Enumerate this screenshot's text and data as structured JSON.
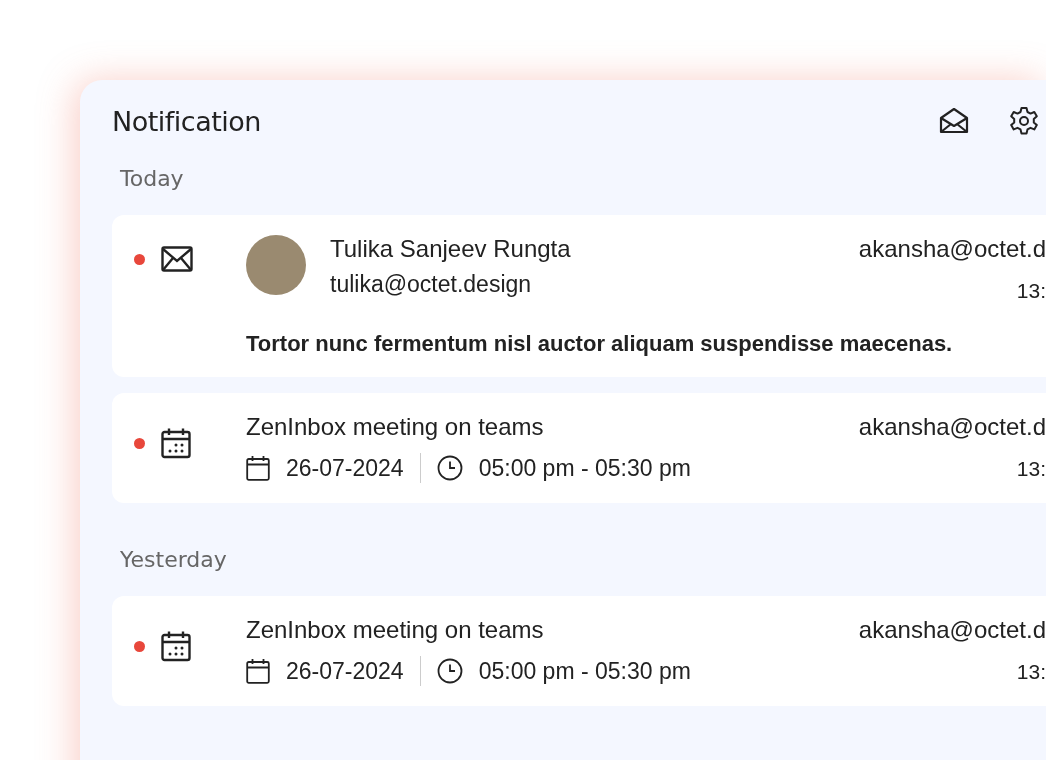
{
  "panel": {
    "title": "Notification"
  },
  "sections": [
    {
      "label": "Today",
      "items": [
        {
          "kind": "email",
          "unread": true,
          "sender": "Tulika Sanjeev Rungta",
          "sender_email": "tulika@octet.design",
          "recipient": "akansha@octet.d",
          "time": "13:",
          "message": "Tortor nunc fermentum nisl auctor aliquam suspendisse maecenas."
        },
        {
          "kind": "meeting",
          "unread": true,
          "title": "ZenInbox meeting on teams",
          "date": "26-07-2024",
          "time_range": "05:00 pm - 05:30 pm",
          "recipient": "akansha@octet.d",
          "time": "13:"
        }
      ]
    },
    {
      "label": "Yesterday",
      "items": [
        {
          "kind": "meeting",
          "unread": true,
          "title": "ZenInbox meeting on teams",
          "date": "26-07-2024",
          "time_range": "05:00 pm - 05:30 pm",
          "recipient": "akansha@octet.d",
          "time": "13:"
        }
      ]
    }
  ]
}
